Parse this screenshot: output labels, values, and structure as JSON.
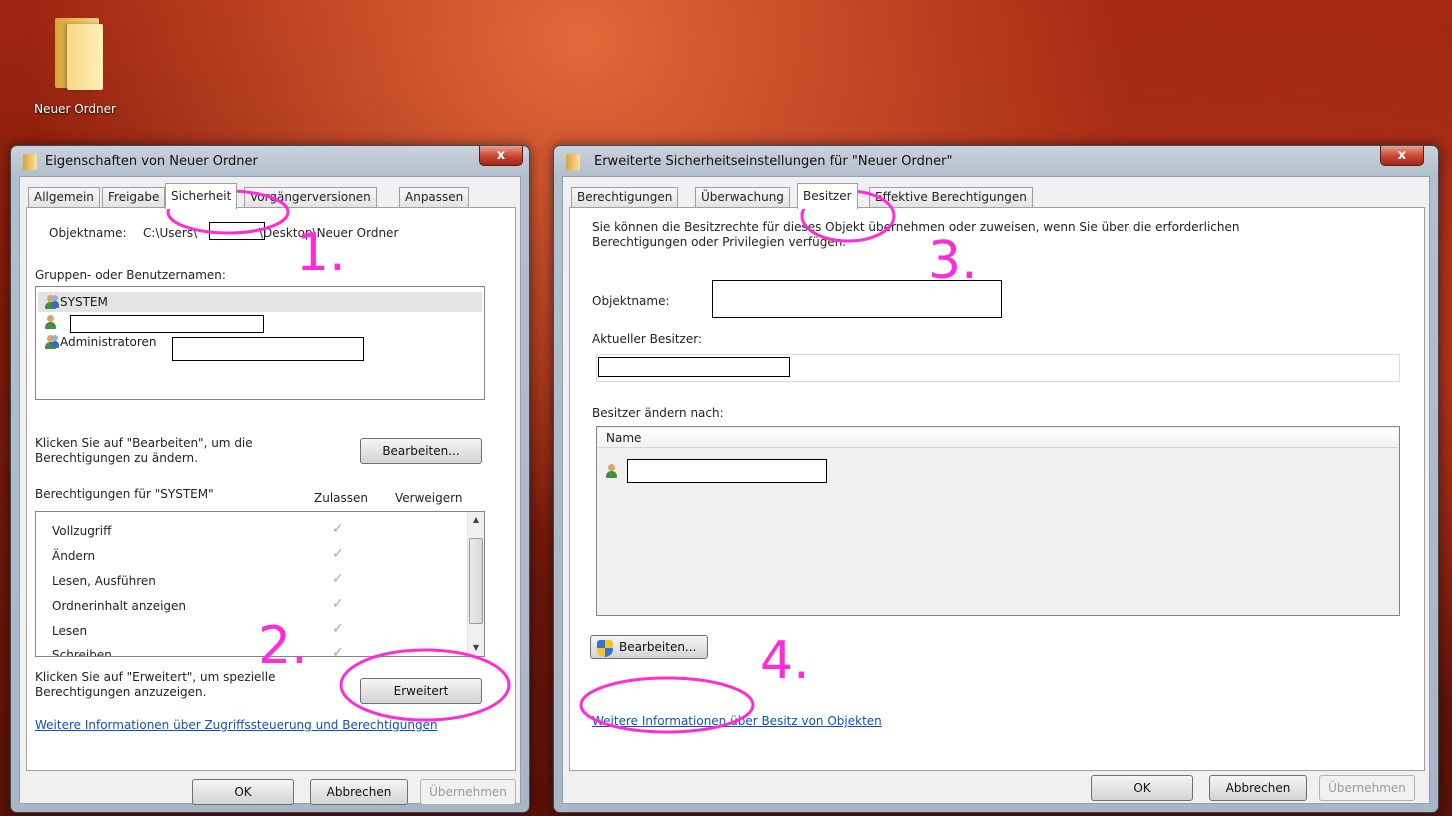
{
  "desktop": {
    "folder_label": "Neuer Ordner"
  },
  "left_window": {
    "title": "Eigenschaften von Neuer Ordner",
    "close_label": "x",
    "tabs": [
      "Allgemein",
      "Freigabe",
      "Sicherheit",
      "Vorgängerversionen",
      "Anpassen"
    ],
    "active_tab": "Sicherheit",
    "object_label": "Objektname:",
    "object_path_prefix": "C:\\Users\\",
    "object_path_suffix": "\\Desktop\\Neuer Ordner",
    "groups_label": "Gruppen- oder Benutzernamen:",
    "groups": [
      "SYSTEM",
      "",
      "Administratoren"
    ],
    "edit_hint": "Klicken Sie auf \"Bearbeiten\", um die Berechtigungen zu ändern.",
    "edit_button": "Bearbeiten...",
    "perm_label": "Berechtigungen für \"SYSTEM\"",
    "col_allow": "Zulassen",
    "col_deny": "Verweigern",
    "permissions": [
      "Vollzugriff",
      "Ändern",
      "Lesen, Ausführen",
      "Ordnerinhalt anzeigen",
      "Lesen",
      "Schreiben"
    ],
    "advanced_hint": "Klicken Sie auf \"Erweitert\", um spezielle Berechtigungen anzuzeigen.",
    "advanced_button": "Erweitert",
    "info_link": "Weitere Informationen über Zugriffssteuerung und Berechtigungen",
    "ok": "OK",
    "cancel": "Abbrechen",
    "apply": "Übernehmen"
  },
  "right_window": {
    "title": "Erweiterte Sicherheitseinstellungen für \"Neuer Ordner\"",
    "close_label": "x",
    "tabs": [
      "Berechtigungen",
      "Überwachung",
      "Besitzer",
      "Effektive Berechtigungen"
    ],
    "active_tab": "Besitzer",
    "intro": "Sie können die Besitzrechte für dieses Objekt übernehmen oder zuweisen, wenn Sie über die erforderlichen Berechtigungen oder Privilegien verfügen.",
    "object_label": "Objektname:",
    "owner_label": "Aktueller Besitzer:",
    "change_label": "Besitzer ändern nach:",
    "name_col": "Name",
    "edit_button": "Bearbeiten...",
    "info_link": "Weitere Informationen über Besitz von Objekten",
    "ok": "OK",
    "cancel": "Abbrechen",
    "apply": "Übernehmen"
  },
  "annotations": [
    "1.",
    "2.",
    "3.",
    "4."
  ],
  "colors": {
    "annotation": "#ff2bd6",
    "link": "#0e52b8"
  }
}
